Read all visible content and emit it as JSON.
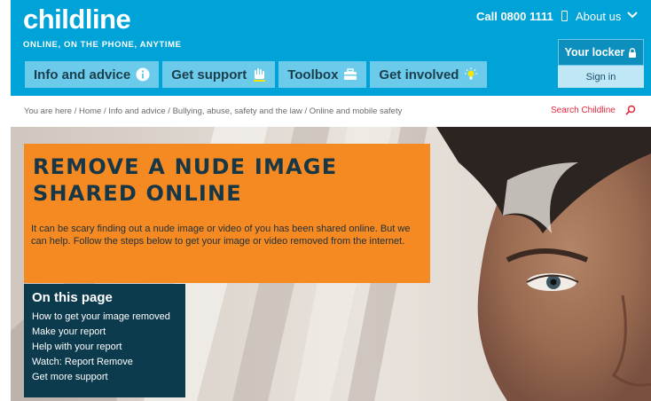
{
  "brand": {
    "logo": "childline",
    "tagline": "ONLINE, ON THE PHONE, ANYTIME"
  },
  "topbar": {
    "call": "Call 0800 1111",
    "about": "About us"
  },
  "locker": {
    "title": "Your locker",
    "signin": "Sign in"
  },
  "nav": {
    "items": [
      {
        "label": "Info and advice",
        "icon": "info-icon"
      },
      {
        "label": "Get support",
        "icon": "hand-icon"
      },
      {
        "label": "Toolbox",
        "icon": "toolbox-icon"
      },
      {
        "label": "Get involved",
        "icon": "lightbulb-icon"
      }
    ]
  },
  "breadcrumb": "You are here / Home / Info and advice / Bullying, abuse, safety and the law / Online and mobile safety",
  "search": {
    "label": "Search Childline"
  },
  "hero": {
    "title": "REMOVE A NUDE IMAGE SHARED ONLINE",
    "intro": "It can be scary finding out a nude image or video of you has been shared online. But we can help. Follow the steps below to get your image or video removed from the internet."
  },
  "toc": {
    "heading": "On this page",
    "items": [
      "How to get your image removed",
      "Make your report",
      "Help with your report",
      "Watch: Report Remove",
      "Get more support"
    ]
  },
  "colors": {
    "header": "#00a3d8",
    "nav": "#6ccbeb",
    "title_box": "#f58a23",
    "toc": "#0d3b4e",
    "search": "#e3283c"
  }
}
